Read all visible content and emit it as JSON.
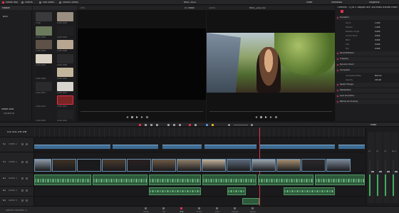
{
  "top_bar": {
    "left_tabs": [
      "Media Pool",
      "Effects",
      "Edit Index",
      "Sound Library"
    ],
    "center_title": "REEL 2022",
    "right_tabs": [
      "Mixer",
      "Metadata",
      "Inspector"
    ],
    "zoom_left": "74%",
    "zoom_right": "100%",
    "left_viewer_label": "01 Inbox",
    "right_viewer_label": "REEL_2022 v2"
  },
  "media_pool": {
    "sidebar_header": "Master",
    "sidebar_items": [
      "Bins"
    ],
    "smart_bins_header": "Smart Bins",
    "smart_bins_items": [
      "Keywords"
    ],
    "clips": [
      {
        "label": "A Clip",
        "color": "#3a3a3c"
      },
      {
        "label": "A 001 C002",
        "color": "#9a8f80"
      },
      {
        "label": "A 001 C003",
        "color": "#6b7a5c"
      },
      {
        "label": "A 001 C004",
        "color": "#202022"
      },
      {
        "label": "A 001 C005",
        "color": "#5e5147"
      },
      {
        "label": "A 001 C006",
        "color": "#b8a690"
      },
      {
        "label": "A 001 C007",
        "color": "#d9d2c4"
      },
      {
        "label": "A 001 C008",
        "color": "#2b2b2d"
      },
      {
        "label": "A 001 C009",
        "color": "#1a1a1c"
      },
      {
        "label": "A 001 C010",
        "color": "#c4b69c"
      },
      {
        "label": "A 001 C011",
        "color": "#2a2a2c"
      },
      {
        "label": "A 001 C012",
        "color": "#d8d3cc"
      },
      {
        "label": "A 001 C013",
        "color": "#1c1c1e"
      },
      {
        "label": "A 001 C014",
        "color": "#7a2424"
      },
      {
        "label": "A 001 C015",
        "color": "#1d1d1f"
      },
      {
        "label": "A 001 C016",
        "color": "#222224"
      }
    ]
  },
  "timeline": {
    "timecode": "01:03:59:08",
    "tracks": [
      {
        "id": "V2",
        "name": "Video 2"
      },
      {
        "id": "V1",
        "name": "Video 1"
      },
      {
        "id": "A1",
        "name": "Audio 1"
      },
      {
        "id": "A2",
        "name": "Audio 2"
      },
      {
        "id": "A3",
        "name": "Audio 3"
      }
    ],
    "footer_label": "DaVinci Resolve 17"
  },
  "inspector": {
    "title": "Timeline - 4_06 1 happen are, but thats tribute channel",
    "tabs": [
      "Video",
      "Audio",
      "Effects",
      "Transition",
      "Image",
      "File"
    ],
    "sections": [
      {
        "name": "Transform"
      },
      {
        "name": "Zoom"
      },
      {
        "name": "Position"
      },
      {
        "name": "Rotation Angle"
      },
      {
        "name": "Anchor Point"
      },
      {
        "name": "Pitch"
      },
      {
        "name": "Yaw"
      },
      {
        "name": "Flip"
      },
      {
        "name": "Smart Reframe"
      },
      {
        "name": "Cropping"
      },
      {
        "name": "Dynamic Zoom"
      },
      {
        "name": "Composite"
      },
      {
        "name": "Composite Mode"
      },
      {
        "name": "Opacity"
      },
      {
        "name": "Speed Change"
      },
      {
        "name": "Stabilization"
      },
      {
        "name": "Lens Correction"
      },
      {
        "name": "Retime and Scaling"
      }
    ],
    "values": [
      "1.000",
      "1.000",
      "0.000",
      "0.000",
      "0.000",
      "0.000",
      "0.000",
      "0.000"
    ],
    "composite_mode_value": "Normal",
    "opacity_value": "100.00"
  },
  "mixer": {
    "title": "Mixer",
    "channels": [
      "A1",
      "A2",
      "A3",
      "Bus 1"
    ]
  },
  "page_nav": [
    "Media",
    "Cut",
    "Edit",
    "Fusion",
    "Color",
    "Fairlight",
    "Deliver"
  ],
  "colors": {
    "accent": "#e0314b",
    "playhead": "#e0314b",
    "video_clip": "#3d6c93",
    "audio_clip": "#2d5a3a"
  }
}
